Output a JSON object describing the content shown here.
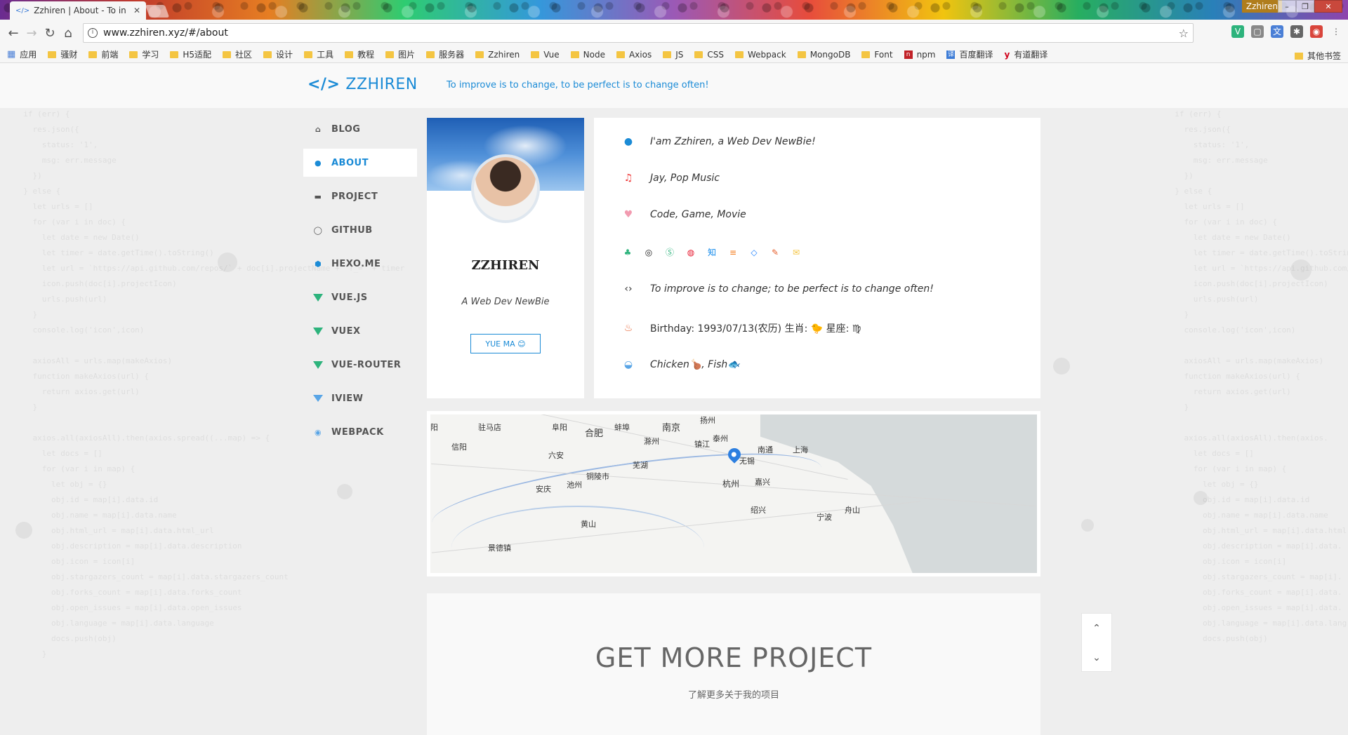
{
  "browser": {
    "tab_title": "Zzhiren | About - To in",
    "tab_icon": "</>",
    "tab_close": "✕",
    "profile_name": "Zzhiren",
    "url": "www.zzhiren.xyz/#/about"
  },
  "bookmarks": {
    "apps_label": "应用",
    "items": [
      "骚财",
      "前端",
      "学习",
      "H5适配",
      "社区",
      "设计",
      "工具",
      "教程",
      "图片",
      "服务器",
      "Zzhiren",
      "Vue",
      "Node",
      "Axios",
      "JS",
      "CSS",
      "Webpack",
      "MongoDB",
      "Font"
    ],
    "npm": "npm",
    "baidu": "百度翻译",
    "youdao": "有道翻译",
    "other": "其他书签"
  },
  "site": {
    "logo_icon": "</>",
    "logo_text": "ZZHIREN",
    "tagline": "To improve is to change, to be perfect is to change often!"
  },
  "sidenav": [
    {
      "label": "BLOG",
      "icon": "home-icon"
    },
    {
      "label": "ABOUT",
      "icon": "user-icon",
      "active": true
    },
    {
      "label": "PROJECT",
      "icon": "folder-icon"
    },
    {
      "label": "GITHUB",
      "icon": "github-icon"
    },
    {
      "label": "HEXO.ME",
      "icon": "hexo-icon"
    },
    {
      "label": "VUE.JS",
      "icon": "vue-icon"
    },
    {
      "label": "VUEX",
      "icon": "vue-icon"
    },
    {
      "label": "VUE-ROUTER",
      "icon": "vue-icon"
    },
    {
      "label": "IVIEW",
      "icon": "iview-icon"
    },
    {
      "label": "WEBPACK",
      "icon": "webpack-icon"
    }
  ],
  "profile": {
    "name": "ZZHIREN",
    "subtitle": "A Web Dev NewBie",
    "button": "YUE MA 😊"
  },
  "info": {
    "intro": "I'am Zzhiren, a Web Dev NewBie!",
    "music": "Jay, Pop Music",
    "hobbies": "Code, Game, Movie",
    "motto": "To improve is to change; to be perfect is to change often!",
    "birthday": "Birthday: 1993/07/13(农历)  生肖: 🐤  星座: ♍",
    "food": "Chicken🍗, Fish🐟"
  },
  "map": {
    "cities": [
      "阳",
      "驻马店",
      "阜阳",
      "蚌埠",
      "合肥",
      "南京",
      "扬州",
      "信阳",
      "滁州",
      "泰州",
      "六安",
      "镇江",
      "南通",
      "上海",
      "芜湖",
      "铜陵市",
      "无锡",
      "池州",
      "安庆",
      "杭州",
      "嘉兴",
      "舟山",
      "绍兴",
      "宁波",
      "黄山",
      "景德镇"
    ]
  },
  "more": {
    "title": "GET MORE PROJECT",
    "subtitle": "了解更多关于我的项目"
  },
  "scroll": {
    "up": "⌃",
    "down": "⌄"
  },
  "colors": {
    "accent": "#1b8bd6",
    "vue_green": "#2db37c"
  }
}
